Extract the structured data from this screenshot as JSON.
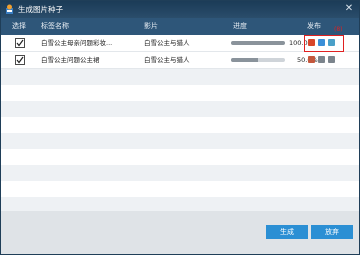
{
  "window": {
    "title": "生成图片种子",
    "close_glyph": "✕"
  },
  "columns": {
    "select": "选择",
    "tag_name": "标签名称",
    "film": "影片",
    "progress": "进度",
    "publish": "发布"
  },
  "rows": [
    {
      "checked": true,
      "tag_name": "白雪公主母亲问题彩妆...",
      "film": "白雪公主与猎人",
      "progress_label": "100.0%",
      "progress_value": 1.0,
      "publish_icons": [
        "red-icon",
        "blue-icon",
        "blue-icon"
      ]
    },
    {
      "checked": true,
      "tag_name": "白雪公主问题公主裙",
      "film": "白雪公主与猎人",
      "progress_label": "50.0%",
      "progress_value": 0.5,
      "publish_icons": [
        "red-icon",
        "gray-icon",
        "gray-icon"
      ]
    }
  ],
  "annotation": {
    "callout": "(8)"
  },
  "footer": {
    "generate_label": "生成",
    "abandon_label": "放弃"
  },
  "colors": {
    "titlebar": "#1b3b57",
    "header": "#2e5679",
    "button": "#2b8fd4",
    "highlight": "#e02020"
  }
}
